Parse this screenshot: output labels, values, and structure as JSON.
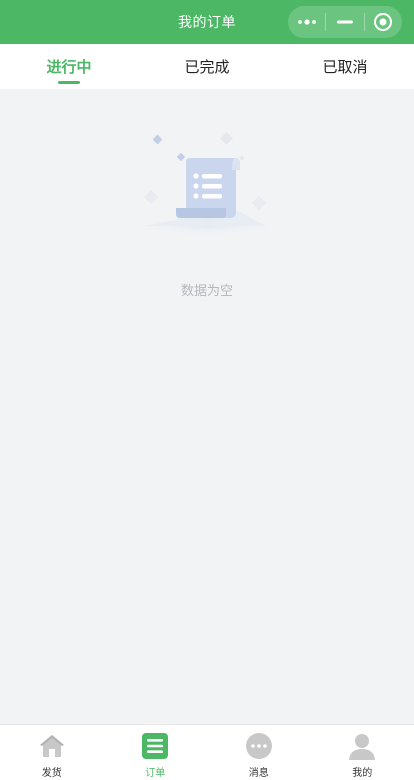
{
  "nav": {
    "title": "我的订单",
    "capsule": {
      "more_icon": "more-dots-icon",
      "minimize_icon": "minimize-icon",
      "close_icon": "target-close-icon"
    }
  },
  "tabs": [
    {
      "label": "进行中",
      "active": true
    },
    {
      "label": "已完成",
      "active": false
    },
    {
      "label": "已取消",
      "active": false
    }
  ],
  "empty_state": {
    "illustration_icon": "empty-list-scroll-icon",
    "text": "数据为空"
  },
  "tabbar": [
    {
      "label": "发货",
      "icon": "home-icon",
      "active": false
    },
    {
      "label": "订单",
      "icon": "order-list-icon",
      "active": true
    },
    {
      "label": "消息",
      "icon": "message-icon",
      "active": false
    },
    {
      "label": "我的",
      "icon": "user-icon",
      "active": false
    }
  ],
  "colors": {
    "primary": "#4cb866",
    "background": "#f2f3f5",
    "muted_text": "#b4b7bd",
    "inactive_icon": "#c8c8c8"
  }
}
